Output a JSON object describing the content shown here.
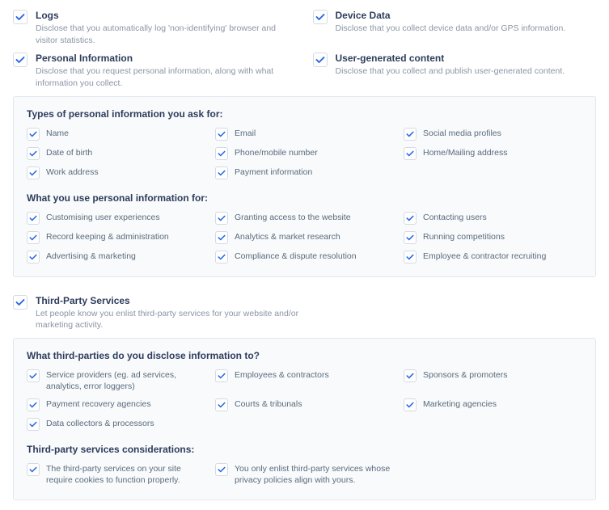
{
  "topItems": [
    {
      "title": "Logs",
      "desc": "Disclose that you automatically log 'non-identifying' browser and visitor statistics."
    },
    {
      "title": "Device Data",
      "desc": "Disclose that you collect device data and/or GPS information."
    },
    {
      "title": "Personal Information",
      "desc": "Disclose that you request personal information, along with what information you collect."
    },
    {
      "title": "User-generated content",
      "desc": "Disclose that you collect and publish user-generated content."
    }
  ],
  "panel1": {
    "section1_title": "Types of personal information you ask for:",
    "section1_items": [
      "Name",
      "Email",
      "Social media profiles",
      "Date of birth",
      "Phone/mobile number",
      "Home/Mailing address",
      "Work address",
      "Payment information"
    ],
    "section2_title": "What you use personal information for:",
    "section2_items": [
      "Customising user experiences",
      "Granting access to the website",
      "Contacting users",
      "Record keeping & administration",
      "Analytics & market research",
      "Running competitions",
      "Advertising & marketing",
      "Compliance & dispute resolution",
      "Employee & contractor recruiting"
    ]
  },
  "thirdParty": {
    "title": "Third-Party Services",
    "desc": "Let people know you enlist third-party services for your website and/or marketing activity."
  },
  "panel2": {
    "section1_title": "What third-parties do you disclose information to?",
    "section1_items": [
      "Service providers (eg. ad services, analytics, error loggers)",
      "Employees & contractors",
      "Sponsors & promoters",
      "Payment recovery agencies",
      "Courts & tribunals",
      "Marketing agencies",
      "Data collectors & processors"
    ],
    "section2_title": "Third-party services considerations:",
    "section2_items": [
      "The third-party services on your site require cookies to function properly.",
      "You only enlist third-party services whose privacy policies align with yours."
    ]
  }
}
